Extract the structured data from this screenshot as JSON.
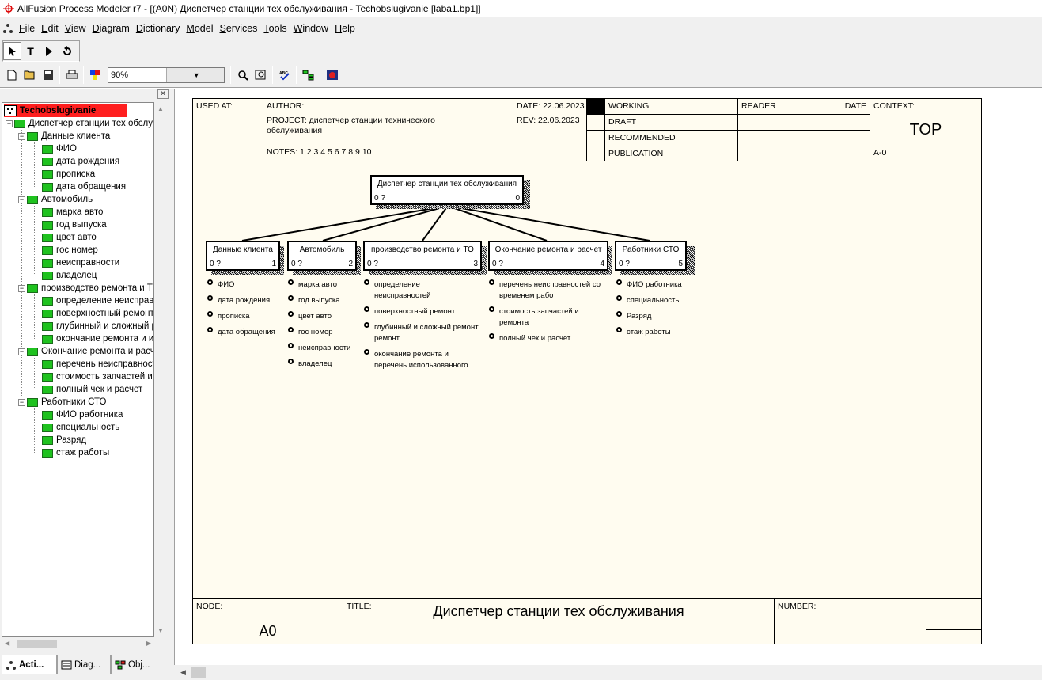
{
  "window": {
    "title": "AllFusion Process Modeler r7 - [(A0N) Диспетчер станции тех обслуживания - Techobslugivanie  [laba1.bp1]]"
  },
  "menu": [
    "File",
    "Edit",
    "View",
    "Diagram",
    "Dictionary",
    "Model",
    "Services",
    "Tools",
    "Window",
    "Help"
  ],
  "toolbar": {
    "zoom": "90%",
    "close": "×"
  },
  "tree": {
    "root": "Techobslugivanie",
    "top": "Диспетчер станции тех обслу",
    "g1": "Данные клиента",
    "g1items": [
      "ФИО",
      "дата рождения",
      "прописка",
      "дата обращения"
    ],
    "g2": "Автомобиль",
    "g2items": [
      "марка авто",
      "год выпуска",
      "цвет авто",
      "гос номер",
      "неисправности",
      "владелец"
    ],
    "g3": "производство ремонта  и Т",
    "g3items": [
      "определение неисправн",
      "поверхностный ремонт",
      "глубинный и сложный р",
      "окончание  ремонта и  и"
    ],
    "g4": "Окончание ремонта и расч",
    "g4items": [
      "перечень неисправност",
      "стоимость запчастей и",
      "полный чек и расчет"
    ],
    "g5": "Работники СТО",
    "g5items": [
      "ФИО работника",
      "специальность",
      "Разряд",
      "стаж работы"
    ]
  },
  "tabs": [
    "Acti...",
    "Diag...",
    "Obj..."
  ],
  "header": {
    "used_at": "USED AT:",
    "author": "AUTHOR:",
    "project": "PROJECT:  диспетчер станции технического обслуживания",
    "notes": "NOTES:  1  2  3  4  5  6  7  8  9  10",
    "date": "DATE:  22.06.2023",
    "rev": "REV:    22.06.2023",
    "working": "WORKING",
    "draft": "DRAFT",
    "recommended": "RECOMMENDED",
    "publication": "PUBLICATION",
    "reader": "READER",
    "reader_date": "DATE",
    "context": "CONTEXT:",
    "top": "TOP",
    "a0": "A-0"
  },
  "diagram": {
    "main": {
      "title": "Диспетчер станции тех обслуживания",
      "left": "0 ?",
      "right": "0"
    },
    "blocks": [
      {
        "title": "Данные клиента",
        "left": "0 ?",
        "right": "1"
      },
      {
        "title": "Автомобиль",
        "left": "0 ?",
        "right": "2"
      },
      {
        "title": "производство ремонта  и ТО",
        "left": "0 ?",
        "right": "3"
      },
      {
        "title": "Окончание ремонта и расчет",
        "left": "0 ?",
        "right": "4"
      },
      {
        "title": "Работники СТО",
        "left": "0 ?",
        "right": "5"
      }
    ],
    "lists": [
      [
        "ФИО",
        "дата рождения",
        "прописка",
        "дата обращения"
      ],
      [
        "марка авто",
        "год выпуска",
        "цвет авто",
        "гос номер",
        "неисправности",
        "владелец"
      ],
      [
        "определение неисправностей",
        "поверхностный  ремонт",
        "глубинный и сложный ремонт ремонт",
        "окончание  ремонта и перечень использованного"
      ],
      [
        "перечень неисправностей со временем  работ",
        "стоимость запчастей и ремонта",
        "полный чек и расчет"
      ],
      [
        "ФИО работника",
        "специальность",
        "Разряд",
        "стаж работы"
      ]
    ]
  },
  "footer": {
    "node_lbl": "NODE:",
    "node": "A0",
    "title_lbl": "TITLE:",
    "title": "Диспетчер станции тех обслуживания",
    "number_lbl": "NUMBER:"
  }
}
